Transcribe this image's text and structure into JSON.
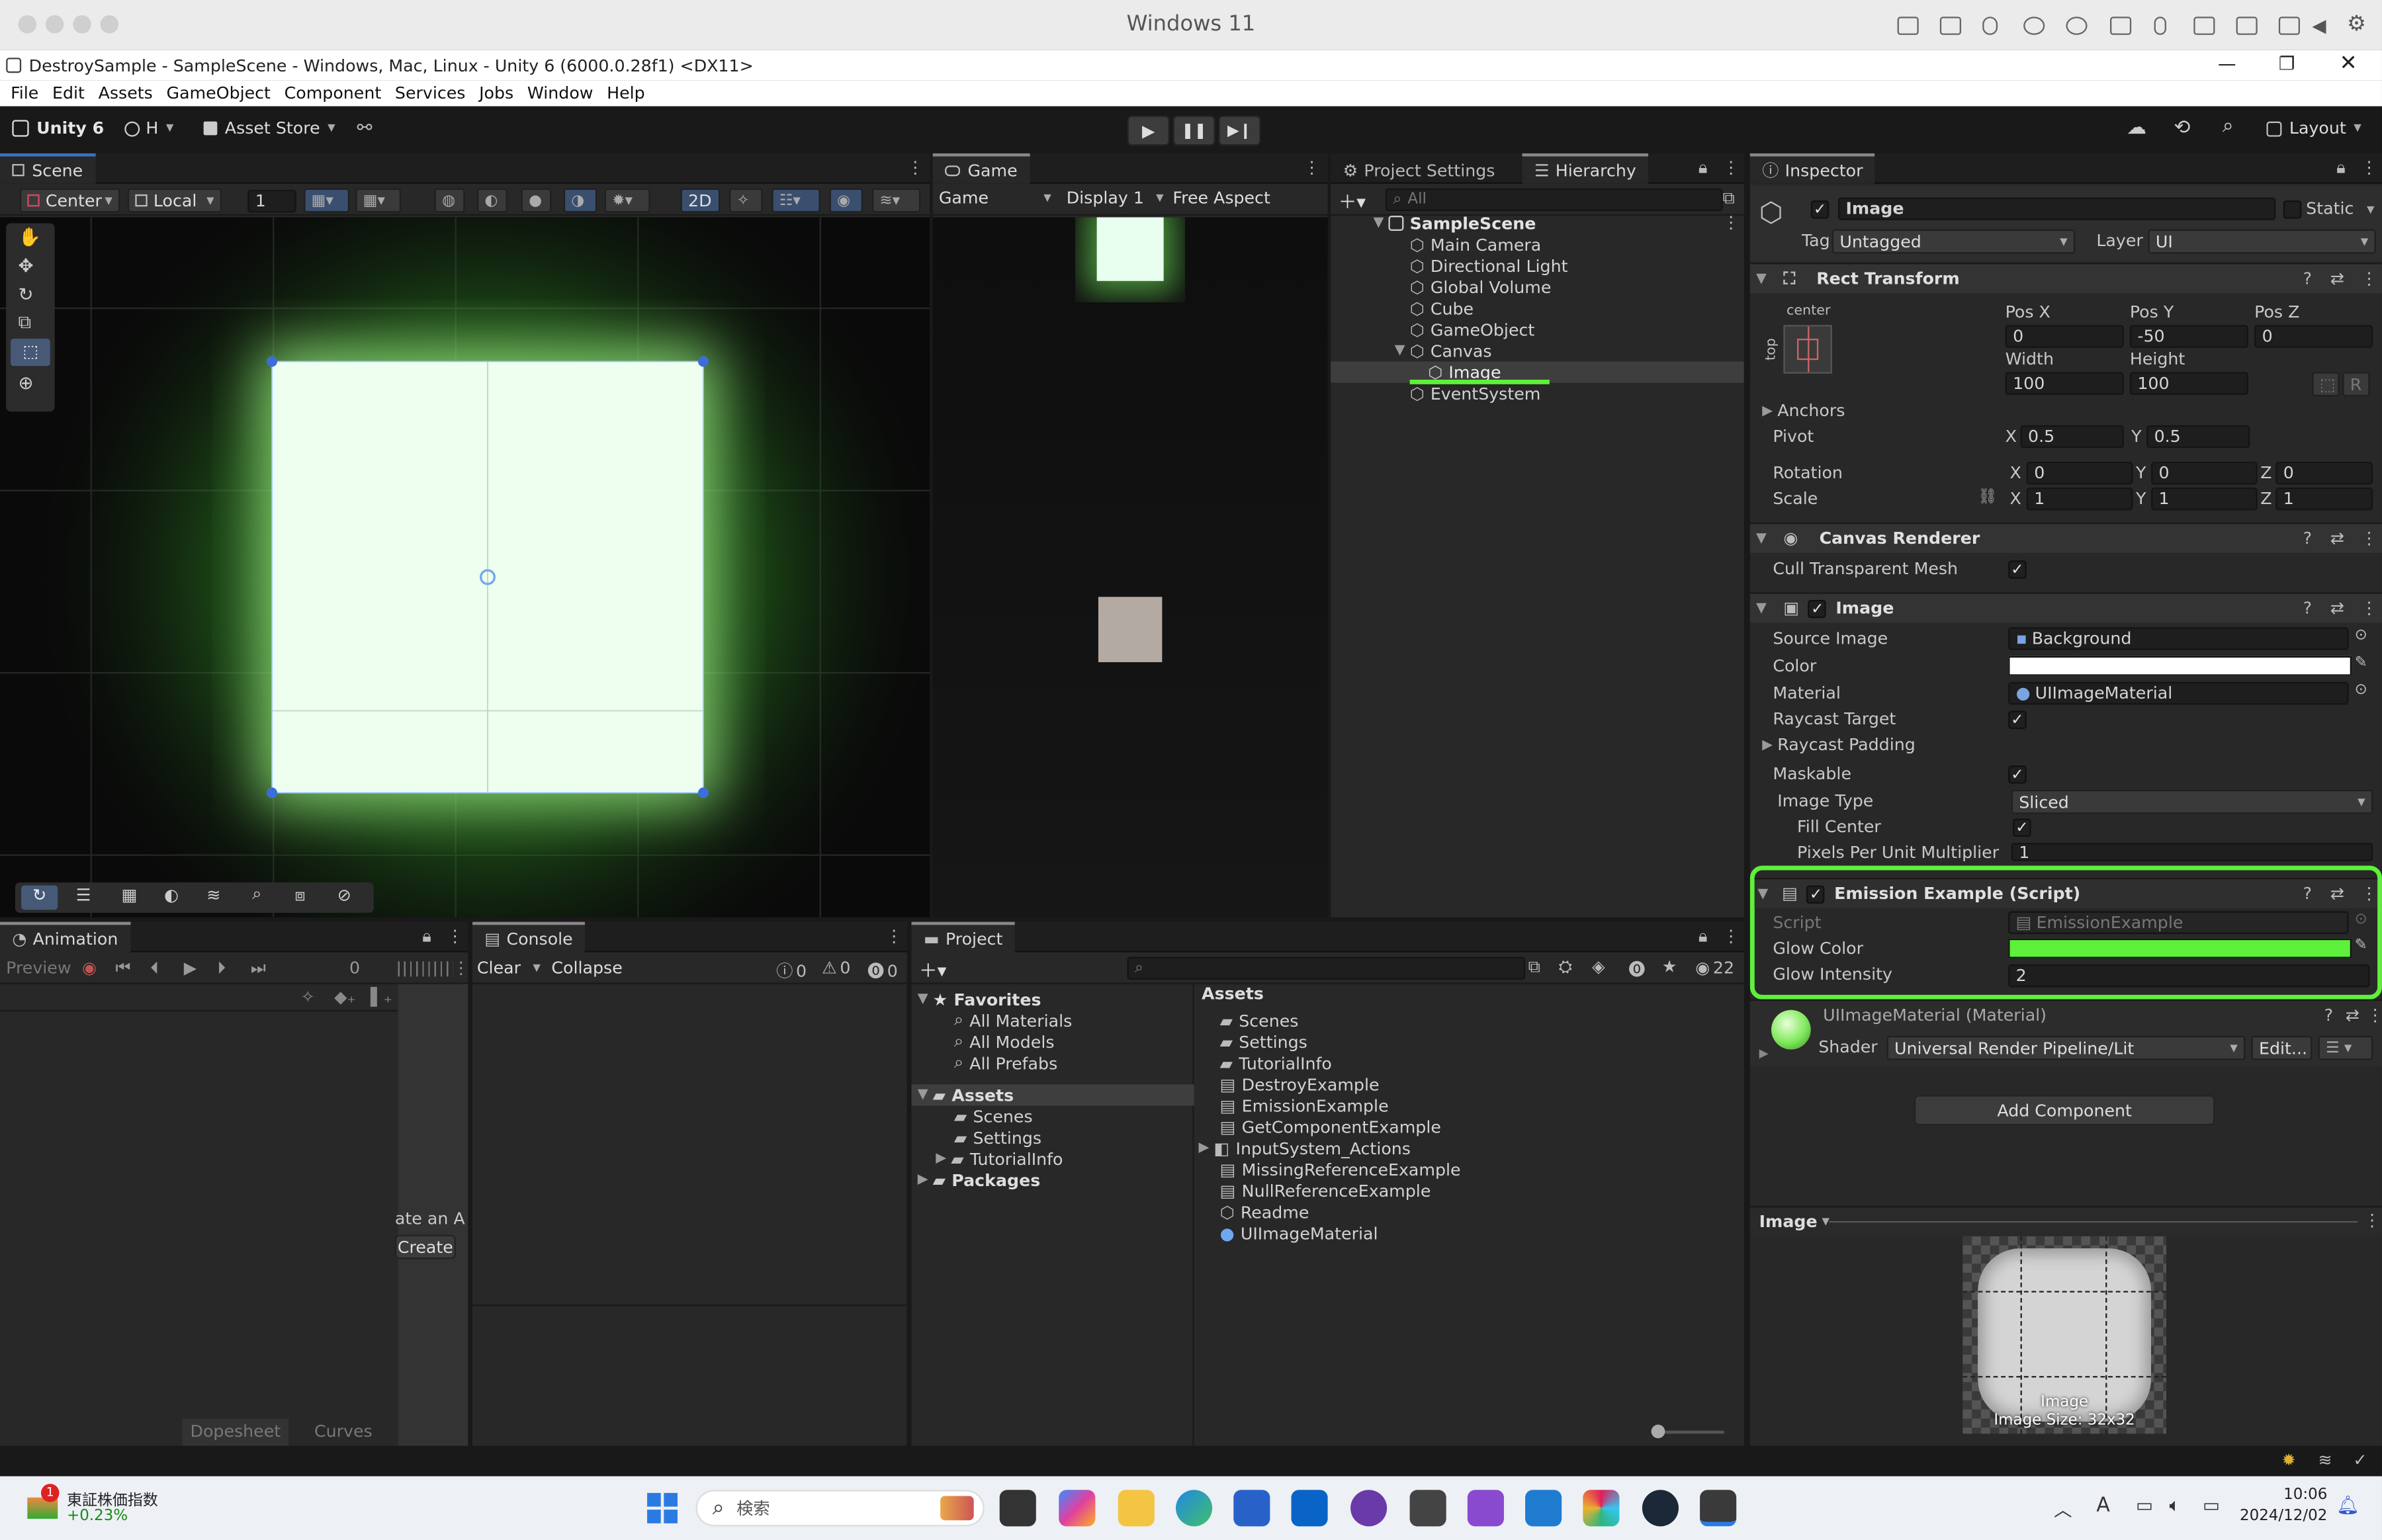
{
  "mac": {
    "title": "Windows 11"
  },
  "window": {
    "title": "DestroySample - SampleScene - Windows, Mac, Linux - Unity 6 (6000.0.28f1) <DX11>"
  },
  "menu": [
    "File",
    "Edit",
    "Assets",
    "GameObject",
    "Component",
    "Services",
    "Jobs",
    "Window",
    "Help"
  ],
  "toolbar": {
    "unity": "Unity 6",
    "account": "H",
    "asset_store": "Asset Store",
    "layout": "Layout"
  },
  "scene": {
    "tab": "Scene",
    "pivot": "Center",
    "space": "Local",
    "grid_value": "1",
    "mode_2d": "2D"
  },
  "game": {
    "tab": "Game",
    "view": "Game",
    "display": "Display 1",
    "aspect": "Free Aspect"
  },
  "hierarchy": {
    "tab_settings": "Project Settings",
    "tab": "Hierarchy",
    "search_placeholder": "All",
    "scene": "SampleScene",
    "items": [
      "Main Camera",
      "Directional Light",
      "Global Volume",
      "Cube",
      "GameObject",
      "Canvas",
      "Image",
      "EventSystem"
    ]
  },
  "inspector": {
    "tab": "Inspector",
    "object_name": "Image",
    "static": "Static",
    "tag_label": "Tag",
    "tag": "Untagged",
    "layer_label": "Layer",
    "layer": "UI",
    "rect": {
      "title": "Rect Transform",
      "anchor": "center",
      "side": "top",
      "posx_label": "Pos X",
      "posy_label": "Pos Y",
      "posz_label": "Pos Z",
      "posx": "0",
      "posy": "-50",
      "posz": "0",
      "width_label": "Width",
      "height_label": "Height",
      "width": "100",
      "height": "100",
      "anchors": "Anchors",
      "pivot": "Pivot",
      "pivot_x": "0.5",
      "pivot_y": "0.5",
      "rotation": "Rotation",
      "rot_x": "0",
      "rot_y": "0",
      "rot_z": "0",
      "scale": "Scale",
      "scale_x": "1",
      "scale_y": "1",
      "scale_z": "1",
      "x": "X",
      "y": "Y",
      "z": "Z",
      "r": "R"
    },
    "canvas_renderer": {
      "title": "Canvas Renderer",
      "cull": "Cull Transparent Mesh"
    },
    "image": {
      "title": "Image",
      "source_image_label": "Source Image",
      "source_image": "Background",
      "color_label": "Color",
      "material_label": "Material",
      "material": "UIImageMaterial",
      "raycast_target": "Raycast Target",
      "raycast_padding": "Raycast Padding",
      "maskable": "Maskable",
      "image_type_label": "Image Type",
      "image_type": "Sliced",
      "fill_center": "Fill Center",
      "ppu_label": "Pixels Per Unit Multiplier",
      "ppu": "1"
    },
    "emission": {
      "title": "Emission Example (Script)",
      "script_label": "Script",
      "script": "EmissionExample",
      "glow_color_label": "Glow Color",
      "glow_color": "#5ef03a",
      "glow_intensity_label": "Glow Intensity",
      "glow_intensity": "2"
    },
    "material": {
      "name": "UIImageMaterial (Material)",
      "shader_label": "Shader",
      "shader": "Universal Render Pipeline/Lit",
      "edit": "Edit..."
    },
    "add_component": "Add Component",
    "preview": {
      "title": "Image",
      "label": "Image",
      "size": "Image Size: 32x32"
    }
  },
  "animation": {
    "tab": "Animation",
    "preview": "Preview",
    "frame": "0",
    "partial": "ate an A",
    "create": "Create",
    "dopesheet": "Dopesheet",
    "curves": "Curves"
  },
  "console": {
    "tab": "Console",
    "clear": "Clear",
    "collapse": "Collapse",
    "info": "0",
    "warn": "0",
    "err": "0"
  },
  "project": {
    "tab": "Project",
    "favorites": "Favorites",
    "fav_items": [
      "All Materials",
      "All Models",
      "All Prefabs"
    ],
    "assets": "Assets",
    "asset_folders": [
      "Scenes",
      "Settings",
      "TutorialInfo"
    ],
    "packages": "Packages",
    "right_title": "Assets",
    "count": "22",
    "right_items": [
      "Scenes",
      "Settings",
      "TutorialInfo",
      "DestroyExample",
      "EmissionExample",
      "GetComponentExample",
      "InputSystem_Actions",
      "MissingReferenceExample",
      "NullReferenceExample",
      "Readme",
      "UIImageMaterial"
    ]
  },
  "taskbar": {
    "stock": "東証株価指数",
    "stock_change": "+0.23%",
    "badge": "1",
    "search": "検索",
    "time": "10:06",
    "date": "2024/12/02",
    "ime": "A"
  },
  "colors": {
    "accent": "#3a72c4",
    "highlight": "#5ef03a",
    "glow": "#8cff7a"
  }
}
